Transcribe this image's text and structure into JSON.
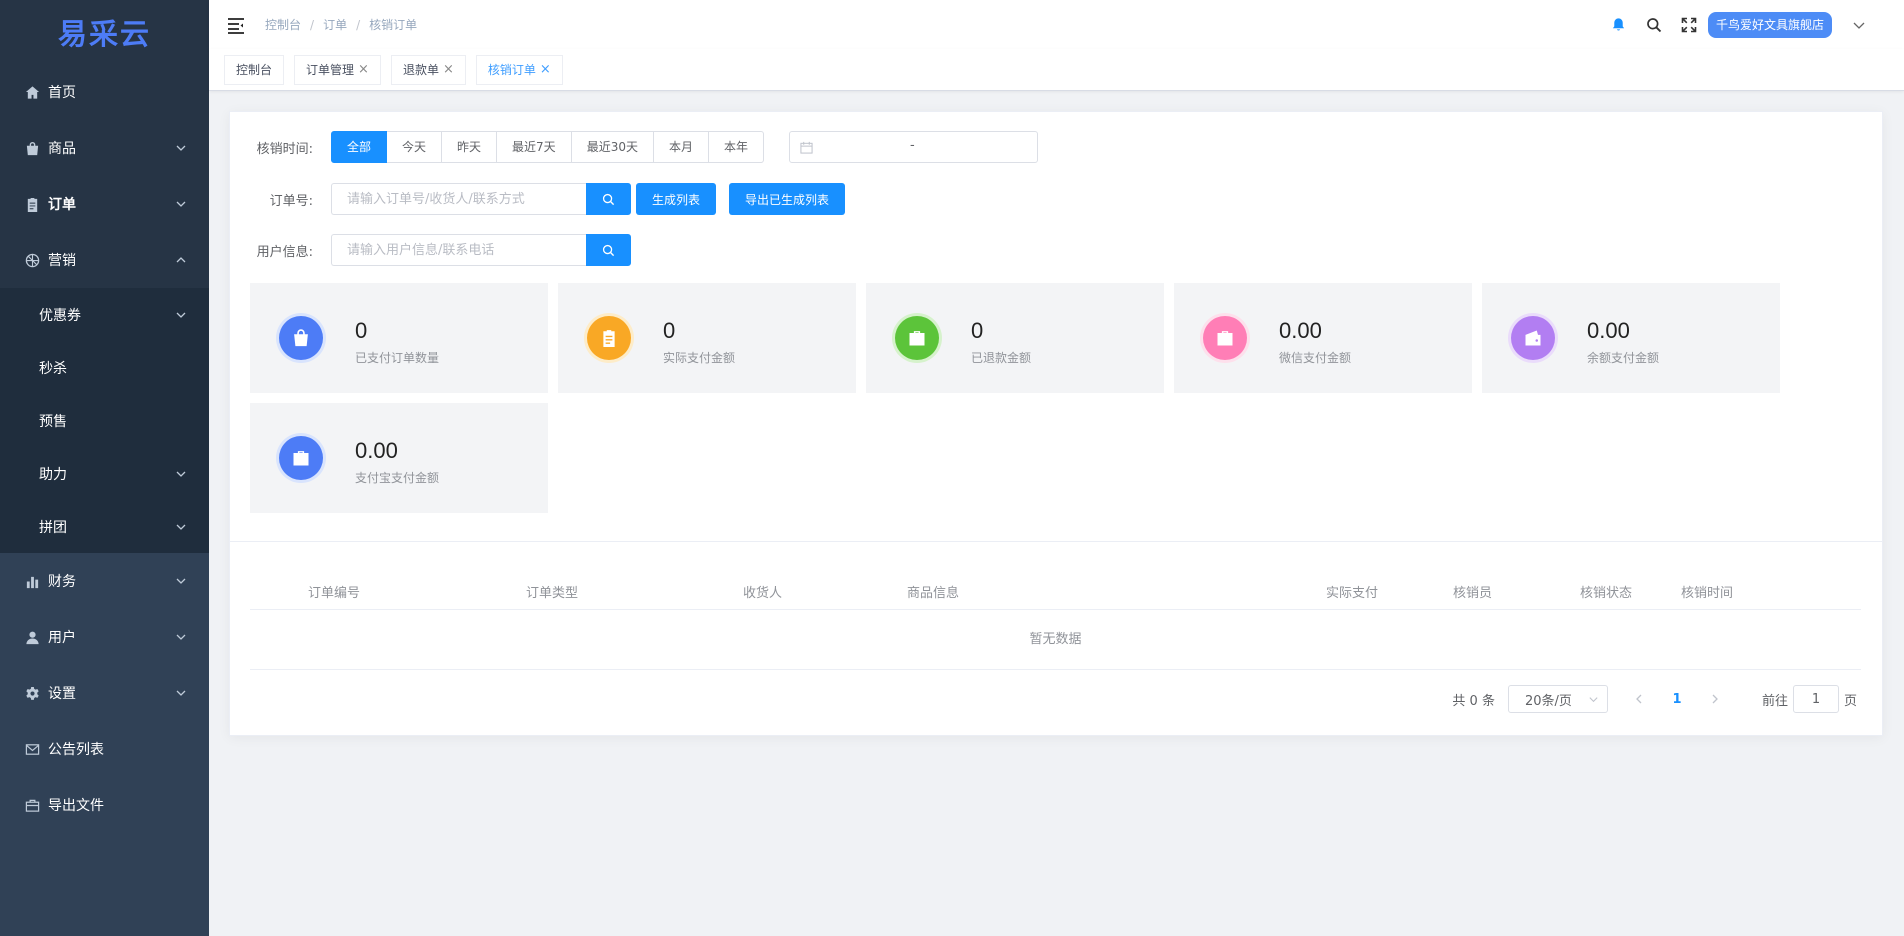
{
  "logo": {
    "text": "易采云"
  },
  "sidebar": {
    "items": [
      {
        "label": "首页",
        "icon": "home-icon"
      },
      {
        "label": "商品",
        "icon": "bag-icon"
      },
      {
        "label": "订单",
        "icon": "clipboard-icon"
      },
      {
        "label": "营销",
        "icon": "aperture-icon"
      },
      {
        "label": "优惠券"
      },
      {
        "label": "秒杀"
      },
      {
        "label": "预售"
      },
      {
        "label": "助力"
      },
      {
        "label": "拼团"
      },
      {
        "label": "财务",
        "icon": "bar-chart-icon"
      },
      {
        "label": "用户",
        "icon": "user-icon"
      },
      {
        "label": "设置",
        "icon": "gear-icon"
      },
      {
        "label": "公告列表",
        "icon": "mail-icon"
      },
      {
        "label": "导出文件",
        "icon": "briefcase-icon"
      }
    ]
  },
  "header": {
    "breadcrumb": [
      "控制台",
      "订单",
      "核销订单"
    ],
    "separator": "/",
    "shop_name": "千鸟爱好文具旗舰店"
  },
  "tags": [
    {
      "label": "控制台",
      "closable": false,
      "active": false
    },
    {
      "label": "订单管理",
      "closable": true,
      "active": false
    },
    {
      "label": "退款单",
      "closable": true,
      "active": false
    },
    {
      "label": "核销订单",
      "closable": true,
      "active": true
    }
  ],
  "tag_close": "×",
  "filters": {
    "time_label": "核销时间:",
    "time_options": [
      "全部",
      "今天",
      "昨天",
      "最近7天",
      "最近30天",
      "本月",
      "本年"
    ],
    "time_selected": "全部",
    "date_separator": "-",
    "order_label": "订单号:",
    "order_placeholder": "请输入订单号/收货人/联系方式",
    "generate_button": "生成列表",
    "export_button": "导出已生成列表",
    "user_label": "用户信息:",
    "user_placeholder": "请输入用户信息/联系电话"
  },
  "stats": [
    {
      "value": "0",
      "label": "已支付订单数量",
      "color": "#4d7cf6",
      "ring": "#d9e4fd",
      "icon": "bag-icon"
    },
    {
      "value": "0",
      "label": "实际支付金额",
      "color": "#f9a825",
      "ring": "#fdecc9",
      "icon": "clipboard-icon"
    },
    {
      "value": "0",
      "label": "已退款金额",
      "color": "#5cc43a",
      "ring": "#d6f2cc",
      "icon": "briefcase-icon"
    },
    {
      "value": "0.00",
      "label": "微信支付金额",
      "color": "#ff7eb6",
      "ring": "#fde0ec",
      "icon": "briefcase-icon"
    },
    {
      "value": "0.00",
      "label": "余额支付金额",
      "color": "#b27ef2",
      "ring": "#eadcfb",
      "icon": "wallet-icon"
    },
    {
      "value": "0.00",
      "label": "支付宝支付金额",
      "color": "#4d7cf6",
      "ring": "#d9e4fd",
      "icon": "briefcase-icon"
    }
  ],
  "table": {
    "columns": [
      "订单编号",
      "订单类型",
      "收货人",
      "商品信息",
      "实际支付",
      "核销员",
      "核销状态",
      "核销时间"
    ],
    "empty_text": "暂无数据"
  },
  "pagination": {
    "total_text": "共 0 条",
    "page_size": "20条/页",
    "current_page": "1",
    "goto_prefix": "前往",
    "goto_value": "1",
    "goto_suffix": "页"
  }
}
